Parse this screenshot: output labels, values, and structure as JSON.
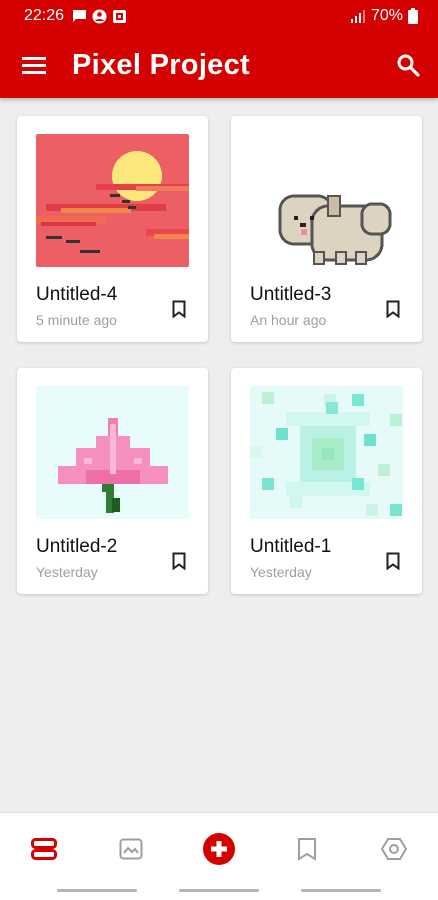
{
  "status": {
    "time": "22:26",
    "battery": "70%"
  },
  "appbar": {
    "title": "Pixel Project"
  },
  "projects": [
    {
      "name": "Untitled-4",
      "time": "5 minute ago",
      "thumb": "sunset"
    },
    {
      "name": "Untitled-3",
      "time": "An hour ago",
      "thumb": "puppy"
    },
    {
      "name": "Untitled-2",
      "time": "Yesterday",
      "thumb": "lotus"
    },
    {
      "name": "Untitled-1",
      "time": "Yesterday",
      "thumb": "pattern"
    }
  ],
  "bottom_nav": [
    "projects-icon",
    "gallery-icon",
    "add-icon",
    "bookmarks-icon",
    "settings-icon"
  ],
  "colors": {
    "primary": "#d50000",
    "inactive": "#9e9e9e"
  }
}
